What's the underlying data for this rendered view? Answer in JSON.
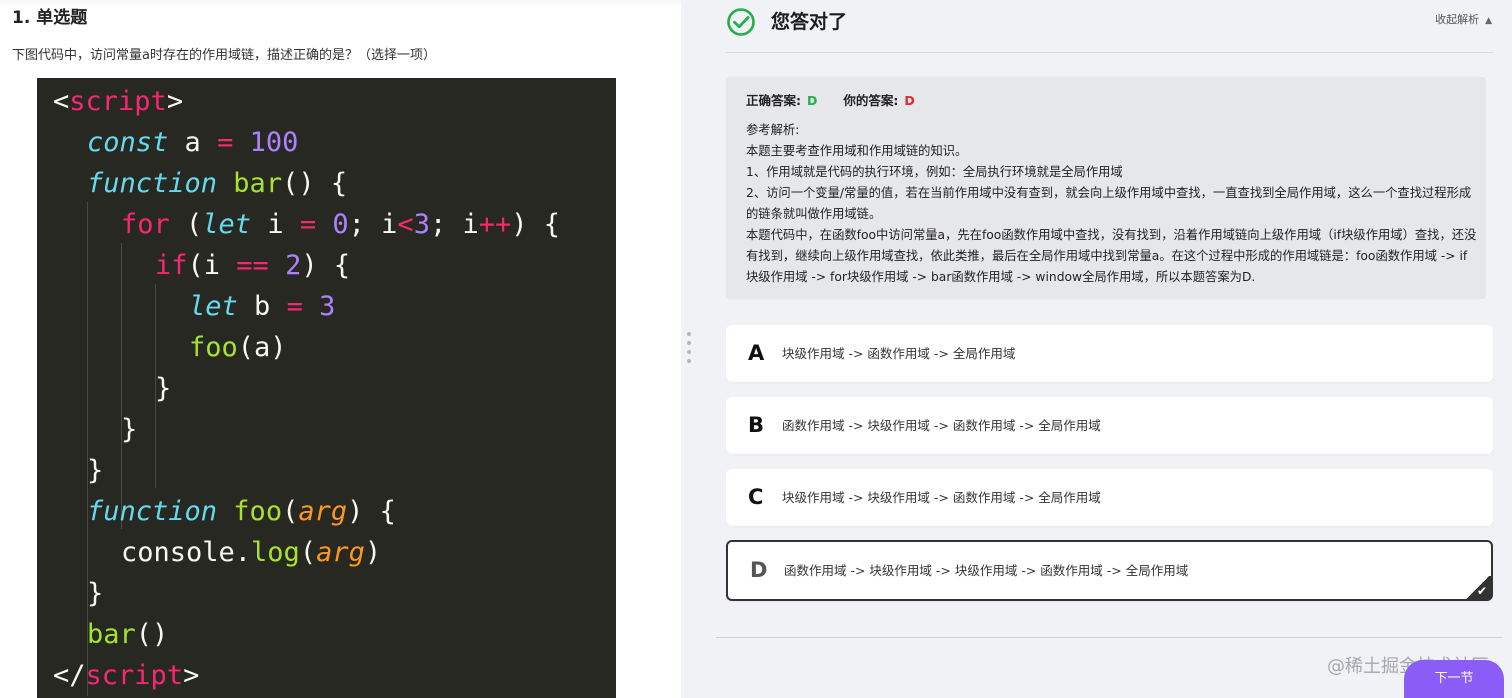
{
  "question": {
    "title": "1. 单选题",
    "text": "下图代码中，访问常量a时存在的作用域链，描述正确的是？（选择一项）"
  },
  "code": {
    "l1": {
      "a": "<",
      "b": "script",
      "c": ">"
    },
    "l2": {
      "a": "const",
      "b": " a ",
      "c": "=",
      "d": " 100"
    },
    "l3": {
      "a": "function",
      "b": " bar",
      "c": "() {"
    },
    "l4": {
      "a": "for",
      "b": " (",
      "c": "let",
      "d": " i ",
      "e": "=",
      "f": " 0",
      "g": "; i",
      "h": "<",
      "i": "3",
      "j": "; i",
      "k": "++",
      "l": ") {"
    },
    "l5": {
      "a": "if",
      "b": "(i ",
      "c": "==",
      "d": " 2",
      "e": ") {"
    },
    "l6": {
      "a": "let",
      "b": " b ",
      "c": "=",
      "d": " 3"
    },
    "l7": {
      "a": "foo",
      "b": "(a)"
    },
    "l8": "}",
    "l9": "}",
    "l10": "}",
    "l11": {
      "a": "function",
      "b": " foo",
      "c": "(",
      "d": "arg",
      "e": ") {"
    },
    "l12": {
      "a": "console.",
      "b": "log",
      "c": "(",
      "d": "arg",
      "e": ")"
    },
    "l13": "}",
    "l14": {
      "a": "bar",
      "b": "()"
    },
    "l15": {
      "a": "</",
      "b": "script",
      "c": ">"
    }
  },
  "result": {
    "title": "您答对了",
    "collapse_label": "收起解析",
    "correct_label": "正确答案:",
    "correct_value": "D",
    "yours_label": "你的答案:",
    "yours_value": "D",
    "explain_heading": "参考解析:",
    "explain_lines": [
      "本题主要考查作用域和作用域链的知识。",
      "1、作用域就是代码的执行环境，例如：全局执行环境就是全局作用域",
      "2、访问一个变量/常量的值，若在当前作用域中没有查到，就会向上级作用域中查找，一直查找到全局作用域，这么一个查找过程形成的链条就叫做作用域链。",
      "本题代码中，在函数foo中访问常量a，先在foo函数作用域中查找，没有找到，沿着作用域链向上级作用域（if块级作用域）查找，还没有找到，继续向上级作用域查找，依此类推，最后在全局作用域中找到常量a。在这个过程中形成的作用域链是：foo函数作用域 -> if块级作用域 -> for块级作用域 -> bar函数作用域 -> window全局作用域，所以本题答案为D."
    ],
    "colors": {
      "correct": "#21b04b",
      "wrong": "#e8262b",
      "check": "#21b04b"
    }
  },
  "options": [
    {
      "letter": "A",
      "text": "块级作用域 -> 函数作用域 -> 全局作用域"
    },
    {
      "letter": "B",
      "text": "函数作用域 -> 块级作用域 -> 函数作用域  -> 全局作用域"
    },
    {
      "letter": "C",
      "text": "块级作用域 -> 块级作用域 -> 函数作用域 -> 全局作用域"
    },
    {
      "letter": "D",
      "text": "函数作用域 -> 块级作用域 -> 块级作用域 -> 函数作用域 -> 全局作用域"
    }
  ],
  "next_label": "下一节",
  "watermark": "@稀土掘金技术社区"
}
